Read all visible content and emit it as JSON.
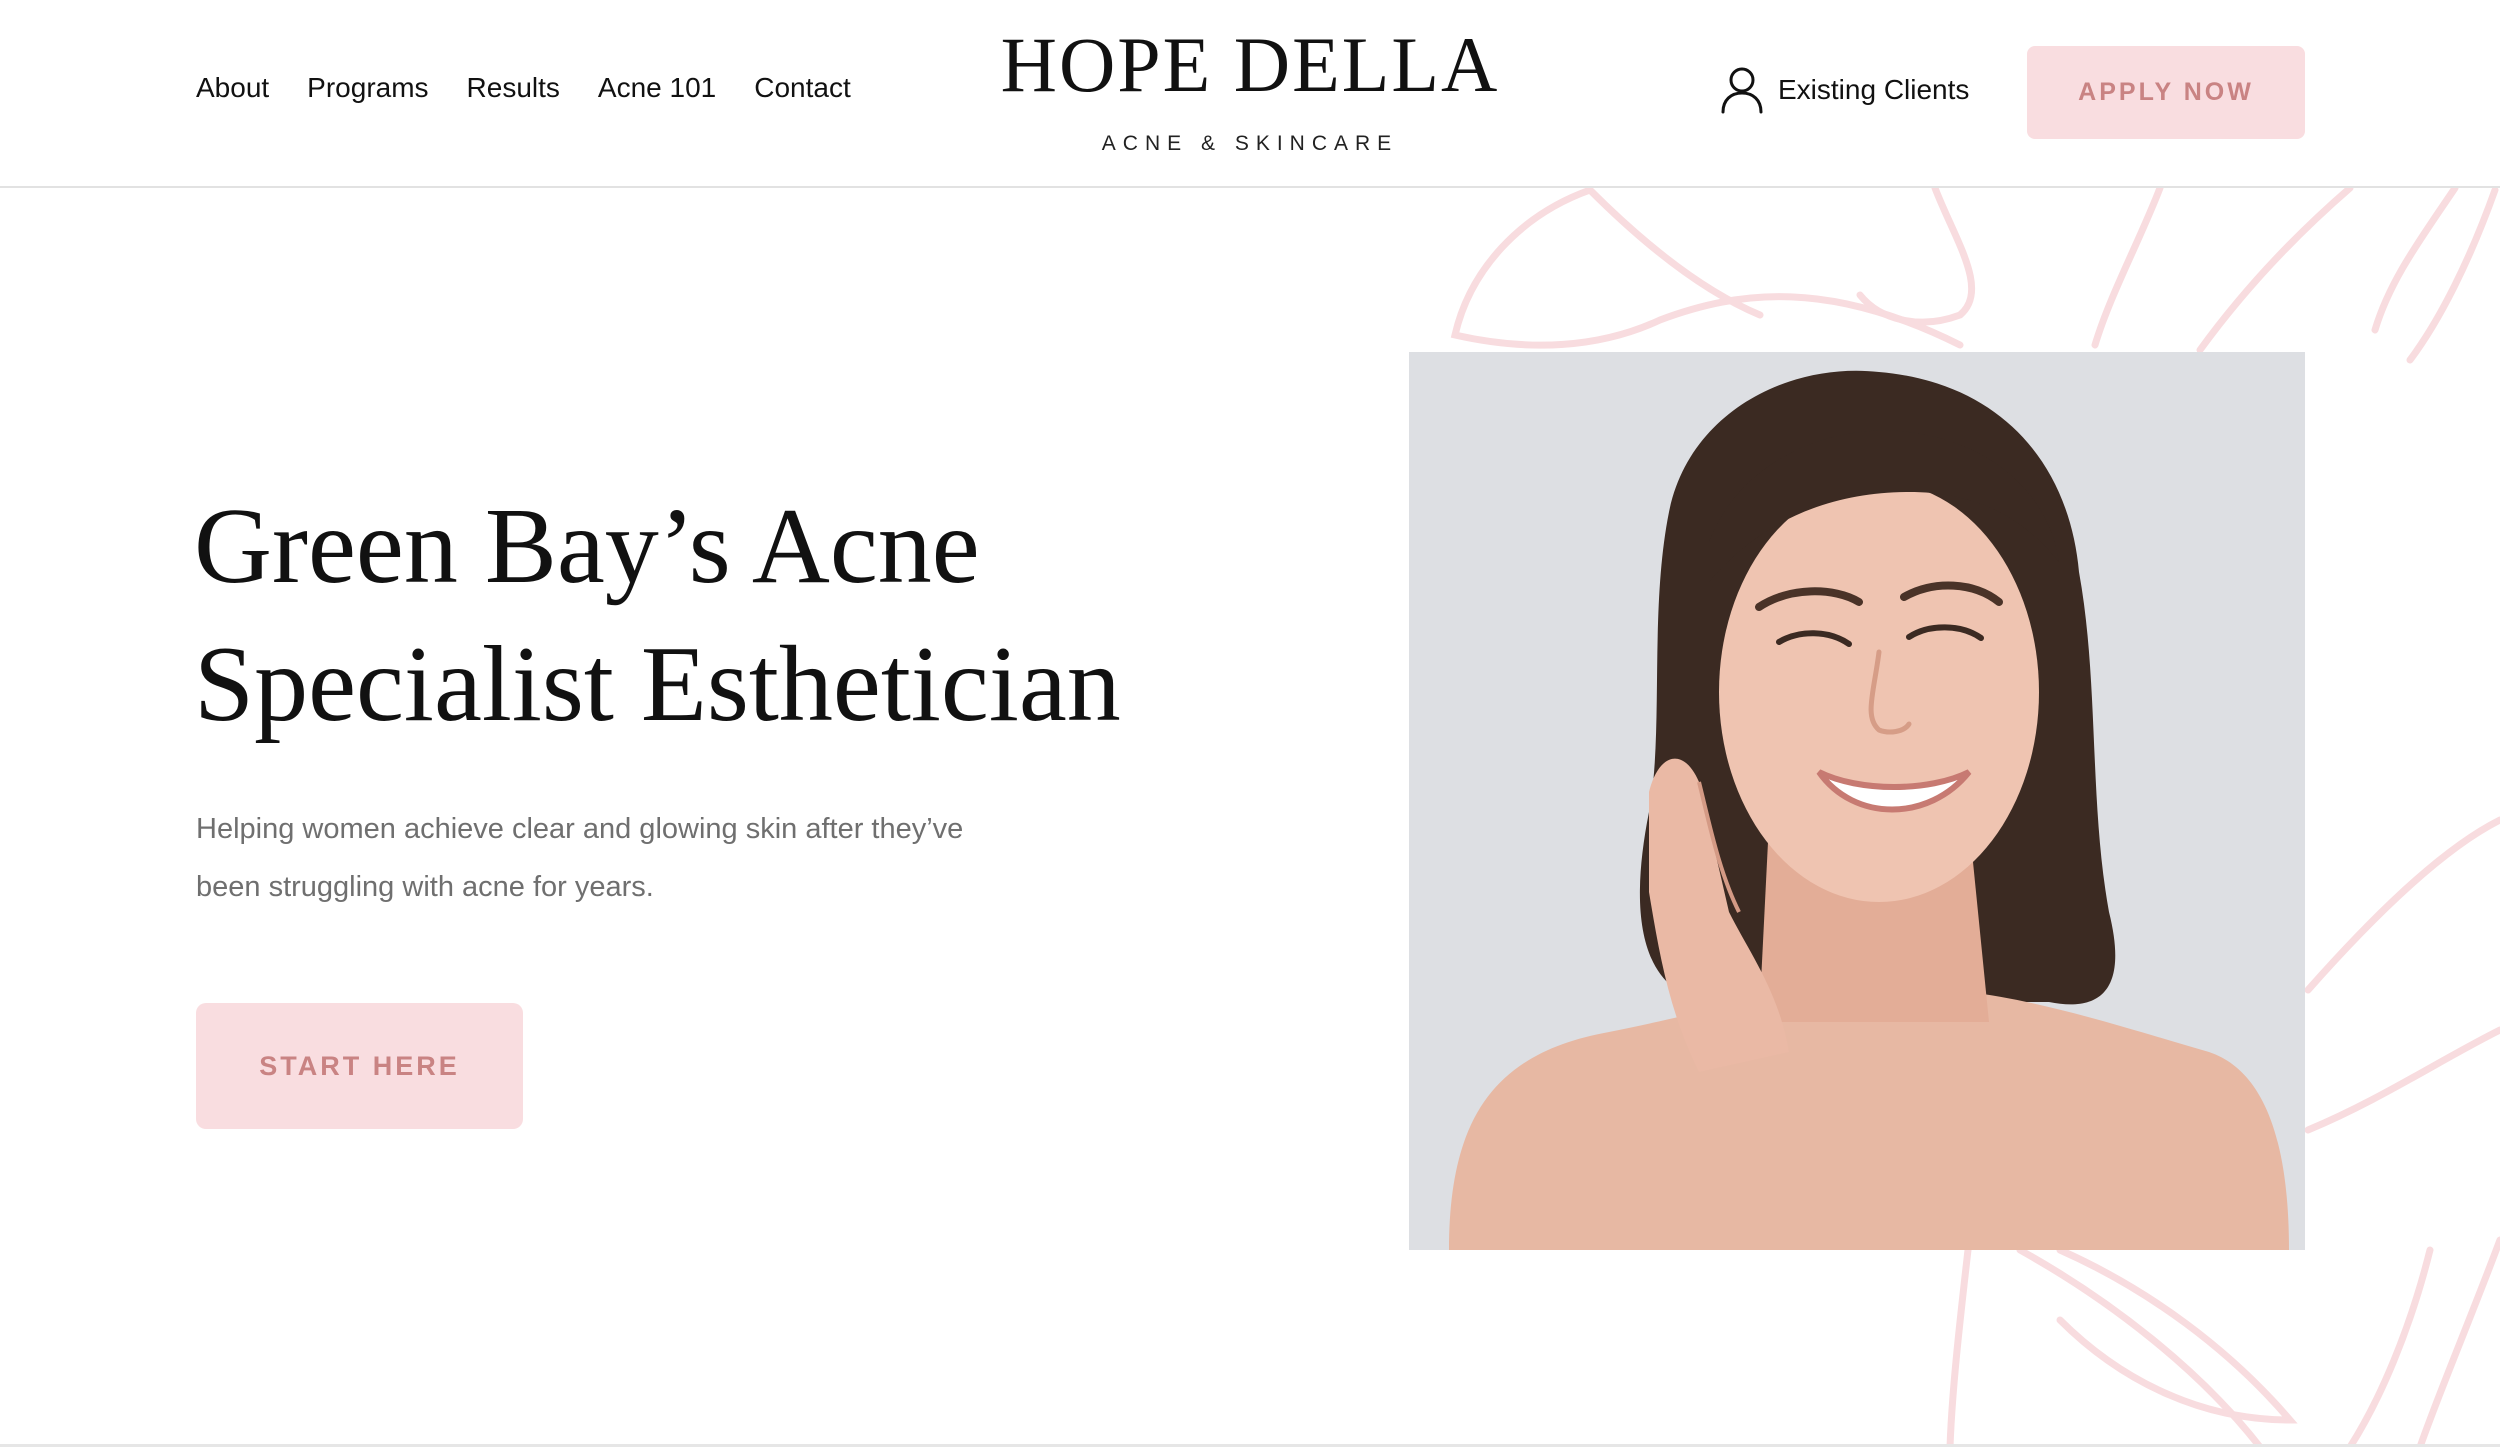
{
  "header": {
    "nav": {
      "about": "About",
      "programs": "Programs",
      "results": "Results",
      "acne101": "Acne 101",
      "contact": "Contact"
    },
    "logo": {
      "title": "HOPE DELLA",
      "subtitle": "ACNE & SKINCARE"
    },
    "existing_clients": {
      "label": "Existing Clients",
      "icon": "user-icon"
    },
    "apply_button": "APPLY NOW"
  },
  "hero": {
    "headline_line1": "Green Bay’s Acne",
    "headline_line2": "Specialist Esthetician",
    "subtext_line1": "Helping women achieve clear and glowing skin after they’ve",
    "subtext_line2": "been struggling with acne for years.",
    "cta_button": "START HERE"
  },
  "colors": {
    "accent_pink": "#f9dde0",
    "accent_text": "#c98383",
    "leaf_line": "#f8dcdf",
    "photo_background": "#dddfe3",
    "body_text": "#6f6f6f"
  }
}
